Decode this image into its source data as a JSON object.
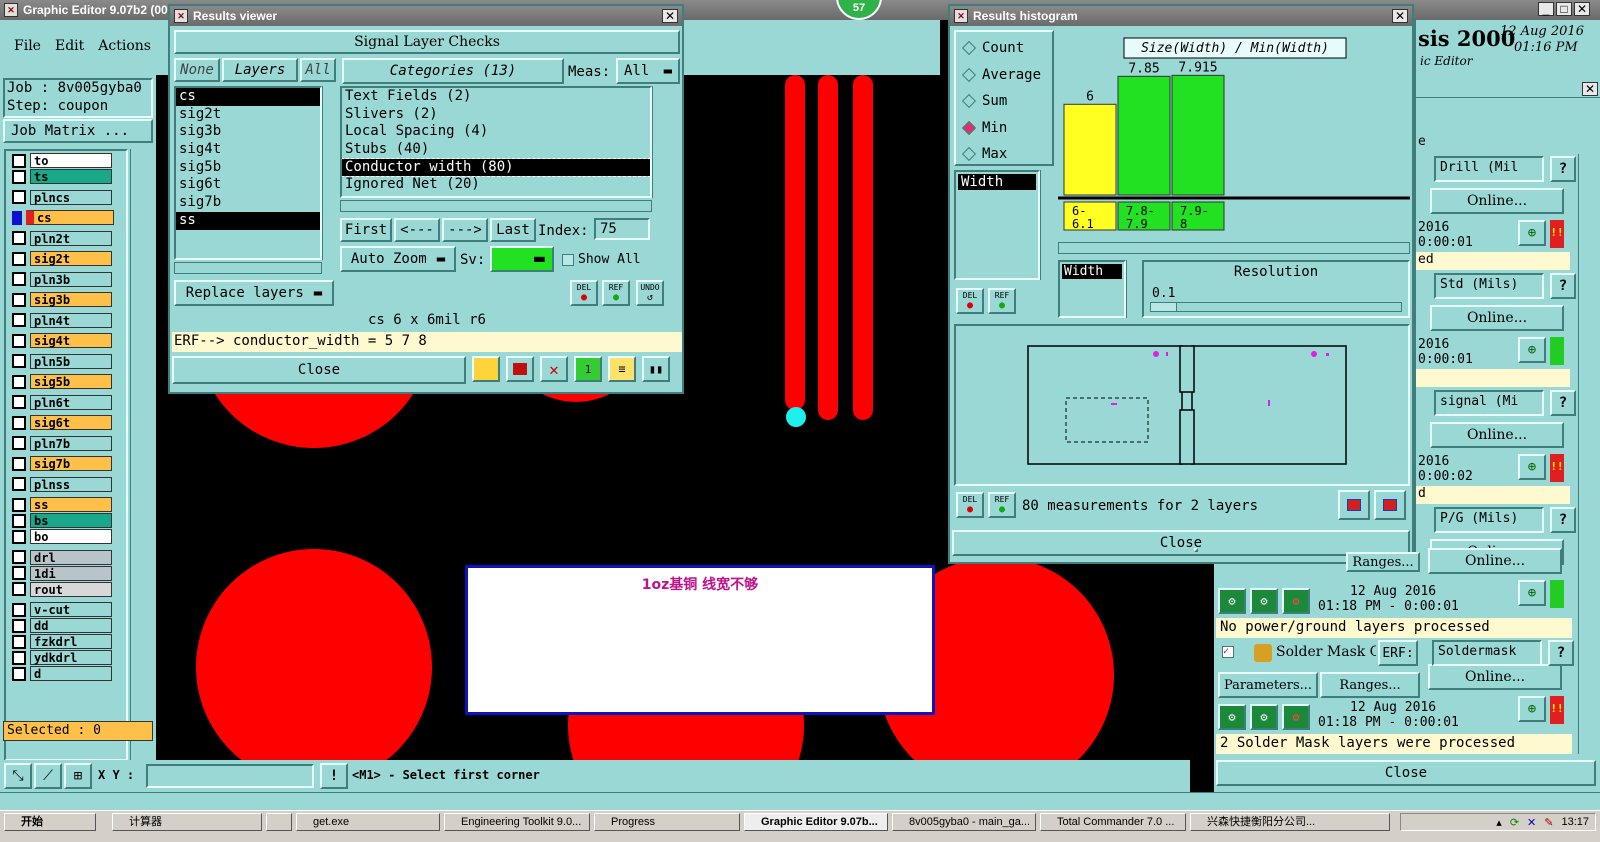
{
  "main": {
    "title": "Graphic Editor 9.07b2 (00",
    "menu": [
      "File",
      "Edit",
      "Actions",
      "("
    ],
    "job_label": "Job : 8v005gyba0",
    "step_label": "Step: coupon",
    "job_matrix": "Job Matrix ...",
    "selected": "Selected : 0",
    "xy_label": "X Y :",
    "status_msg": "<M1> - Select first corner",
    "badge": "57",
    "note_text": "1oz基铜  线宽不够"
  },
  "layers": [
    {
      "name": "to",
      "color": "#ffffff"
    },
    {
      "name": "ts",
      "color": "#1aa88a"
    },
    {
      "name": "plncs",
      "color": "#9ad8d6"
    },
    {
      "name": "cs",
      "color": "#ffc04a",
      "active": true
    },
    {
      "name": "pln2t",
      "color": "#9ad8d6"
    },
    {
      "name": "sig2t",
      "color": "#ffc04a"
    },
    {
      "name": "pln3b",
      "color": "#9ad8d6"
    },
    {
      "name": "sig3b",
      "color": "#ffc04a"
    },
    {
      "name": "pln4t",
      "color": "#9ad8d6"
    },
    {
      "name": "sig4t",
      "color": "#ffc04a"
    },
    {
      "name": "pln5b",
      "color": "#9ad8d6"
    },
    {
      "name": "sig5b",
      "color": "#ffc04a"
    },
    {
      "name": "pln6t",
      "color": "#9ad8d6"
    },
    {
      "name": "sig6t",
      "color": "#ffc04a"
    },
    {
      "name": "pln7b",
      "color": "#9ad8d6"
    },
    {
      "name": "sig7b",
      "color": "#ffc04a"
    },
    {
      "name": "plnss",
      "color": "#9ad8d6"
    },
    {
      "name": "ss",
      "color": "#ffc04a"
    },
    {
      "name": "bs",
      "color": "#1aa88a"
    },
    {
      "name": "bo",
      "color": "#ffffff"
    },
    {
      "name": "drl",
      "color": "#b8c4c8"
    },
    {
      "name": "1di",
      "color": "#b8c4c8"
    },
    {
      "name": "rout",
      "color": "#d8d8d8"
    },
    {
      "name": "v-cut",
      "color": "#9ad8d6"
    },
    {
      "name": "dd",
      "color": "#9ad8d6"
    },
    {
      "name": "fzkdrl",
      "color": "#9ad8d6"
    },
    {
      "name": "ydkdrl",
      "color": "#9ad8d6"
    },
    {
      "name": "d",
      "color": "#9ad8d6"
    }
  ],
  "results_viewer": {
    "title": "Results viewer",
    "header": "Signal Layer Checks",
    "none_btn": "None",
    "layers_btn": "Layers",
    "all_btn": "All",
    "categories_btn": "Categories (13)",
    "meas_label": "Meas:",
    "meas_value": "All",
    "layer_list": [
      "cs",
      "sig2t",
      "sig3b",
      "sig4t",
      "sig5b",
      "sig6t",
      "sig7b",
      "ss"
    ],
    "categories": [
      "Text Fields (2)",
      "Slivers (2)",
      "Local Spacing (4)",
      "Stubs (40)",
      "Conductor width (80)",
      "Ignored Net (20)"
    ],
    "first_btn": "First",
    "prev_btn": "<---",
    "next_btn": "--->",
    "last_btn": "Last",
    "index_label": "Index:",
    "index_value": "75",
    "auto_zoom": "Auto Zoom",
    "sv_label": "Sv:",
    "show_all": "Show All",
    "replace_layers": "Replace layers",
    "del": "DEL",
    "ref": "REF",
    "undo": "UNDO",
    "info": "cs 6 x 6mil  r6",
    "erf": "ERF--> conductor_width = 5 7 8",
    "close": "Close"
  },
  "histogram": {
    "title": "Results histogram",
    "modes": [
      {
        "label": "Count",
        "on": false
      },
      {
        "label": "Average",
        "on": false
      },
      {
        "label": "Sum",
        "on": false
      },
      {
        "label": "Min",
        "on": true
      },
      {
        "label": "Max",
        "on": false
      }
    ],
    "width_item": "Width",
    "width_label": "Width",
    "resolution_label": "Resolution",
    "resolution_value": "0.1",
    "measurements": "80 measurements for 2 layers",
    "close": "Close",
    "del": "DEL",
    "ref": "REF"
  },
  "chart_data": {
    "type": "bar",
    "title": "Size(Width) / Min(Width)",
    "categories": [
      "6-6.1",
      "7.8-7.9",
      "7.9-8"
    ],
    "category_labels": [
      [
        "6-",
        "6.1"
      ],
      [
        "7.8-",
        "7.9"
      ],
      [
        "7.9-",
        "8"
      ]
    ],
    "values": [
      6,
      7.85,
      7.915
    ],
    "value_labels": [
      "6",
      "7.85",
      "7.915"
    ],
    "colors": [
      "#ffff22",
      "#22e022",
      "#22e022"
    ],
    "ylim": [
      0,
      8.4
    ]
  },
  "analysis": {
    "title_partial": "sis 2000",
    "date": "12 Aug 2016",
    "time": "01:16 PM",
    "subtitle": "ic Editor",
    "sections": [
      {
        "erf": "Drill (Mil",
        "online": "Online...",
        "year": "2016",
        "dur": "0:00:01",
        "msg": "ed",
        "status": "#e02020"
      },
      {
        "erf": "Std (Mils)",
        "online": "Online...",
        "year": "2016",
        "dur": "0:00:01",
        "msg": "",
        "status": "#22cc22"
      },
      {
        "erf": "signal (Mi",
        "online": "Online...",
        "year": "2016",
        "dur": "0:00:02",
        "msg": "d",
        "status": "#e02020"
      },
      {
        "erf": "P/G (Mils)",
        "online": "Online...",
        "year": "",
        "dur": "",
        "msg": "",
        "status": ""
      }
    ],
    "pg_params": "Parameters...",
    "pg_ranges": "Ranges...",
    "pg_online": "Online...",
    "pg_date": "12 Aug 2016",
    "pg_time": "01:18 PM - 0:00:01",
    "pg_msg": "No power/ground layers processed",
    "sm_name": "Soldermask",
    "sm_label": "Solder Mask Ch",
    "sm_erf": "ERF:",
    "sm_params": "Parameters...",
    "sm_ranges": "Ranges...",
    "sm_online": "Online...",
    "sm_date": "12 Aug 2016",
    "sm_time": "01:18 PM - 0:00:01",
    "sm_msg": "2 Solder Mask layers were processed",
    "close": "Close",
    "partial_e": "e"
  },
  "taskbar": {
    "start": "开始",
    "items": [
      "计算器",
      "",
      "get.exe",
      "Engineering Toolkit 9.0...",
      "Progress",
      "Graphic Editor 9.07b...",
      "8v005gyba0 - main_ga...",
      "Total Commander 7.0 ...",
      "兴森快捷衡阳分公司..."
    ],
    "clock": "13:17"
  }
}
